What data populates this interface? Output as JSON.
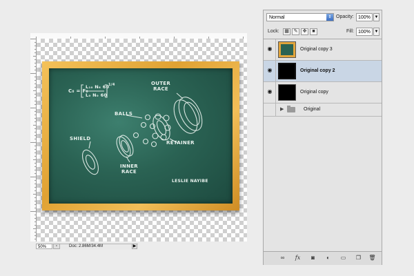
{
  "document": {
    "zoom": "50%",
    "doc_info": "Doc: 2.86M/34.4M",
    "chalkboard": {
      "formula_left": "C₀ = F₀",
      "formula_top": "L₁₀ N₆ 60",
      "formula_bottom": "L₀ N₀ 60",
      "exponent": "1/4",
      "labels": {
        "outer_race": "OUTER\nRACE",
        "balls": "BALLS",
        "shield": "SHIELD",
        "retainer": "RETAINER",
        "inner_race": "INNER\nRACE",
        "signature": "LESLIE NAYIBE"
      }
    }
  },
  "layers_panel": {
    "blend_mode": "Normal",
    "opacity_label": "Opacity:",
    "opacity_value": "100%",
    "lock_label": "Lock:",
    "fill_label": "Fill:",
    "fill_value": "100%",
    "layers": [
      {
        "name": "Original copy 3",
        "visible": true,
        "selected": false,
        "thumb": "chalkboard"
      },
      {
        "name": "Original copy 2",
        "visible": true,
        "selected": true,
        "thumb": "black"
      },
      {
        "name": "Original copy",
        "visible": true,
        "selected": false,
        "thumb": "black"
      }
    ],
    "group": {
      "name": "Original",
      "visible": false,
      "collapsed": true
    },
    "footer_icons": [
      "link-icon",
      "fx-icon",
      "mask-icon",
      "adjustment-icon",
      "new-group-icon",
      "new-layer-icon",
      "trash-icon"
    ]
  }
}
